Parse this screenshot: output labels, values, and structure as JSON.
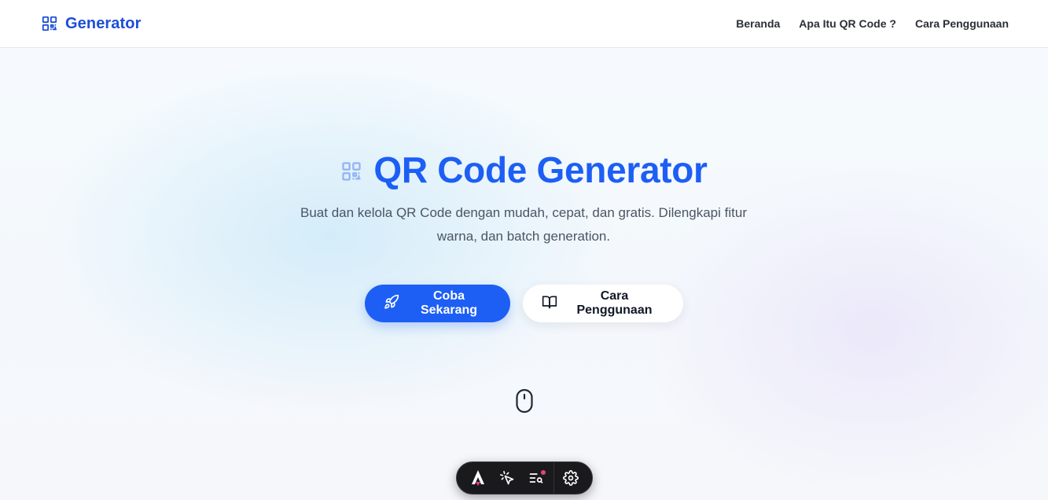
{
  "header": {
    "brand": "Generator",
    "nav": [
      {
        "label": "Beranda"
      },
      {
        "label": "Apa Itu QR Code ?"
      },
      {
        "label": "Cara Penggunaan"
      }
    ]
  },
  "hero": {
    "title": "QR Code Generator",
    "subtitle": "Buat dan kelola QR Code dengan mudah, cepat, dan gratis. Dilengkapi fitur warna, dan batch generation.",
    "primary_button": "Coba Sekarang",
    "secondary_button": "Cara Penggunaan"
  },
  "icons": {
    "brand": "qr-code-icon",
    "title": "qr-code-icon",
    "primary_button": "rocket-icon",
    "secondary_button": "book-open-icon",
    "scroll": "mouse-icon",
    "devbar": [
      "astro-logo-icon",
      "pointer-select-icon",
      "audit-list-icon",
      "gear-icon"
    ]
  },
  "colors": {
    "accent": "#1d5ff5",
    "brand": "#1d4ed8",
    "toolbar_bg": "#1a1a1d",
    "notification_dot": "#e0457b"
  }
}
